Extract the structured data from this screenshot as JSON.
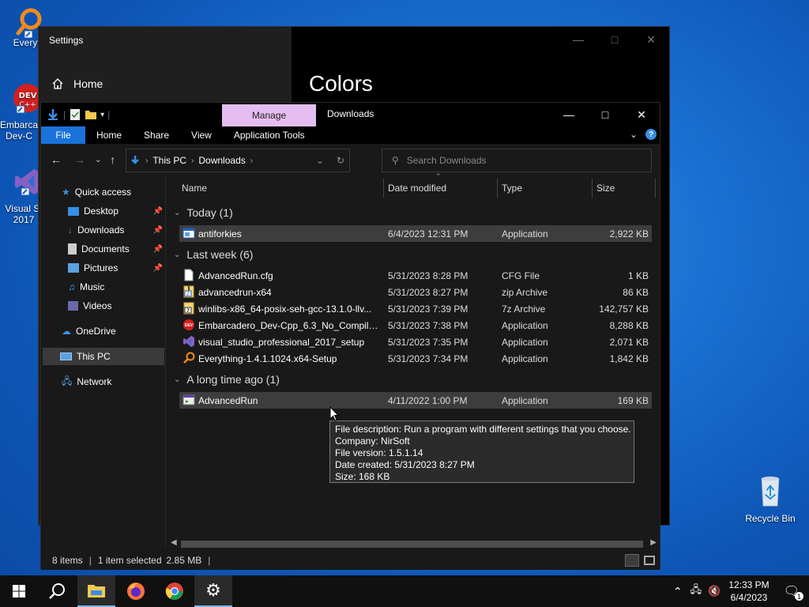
{
  "desktop": {
    "icons": [
      {
        "label": "Everyth",
        "icon": "everything-magnifier-icon"
      },
      {
        "label": "Embarca Dev-C",
        "icon": "devcpp-icon"
      },
      {
        "label": "Visual St 2017",
        "icon": "visual-studio-icon"
      },
      {
        "label": "Recycle Bin",
        "icon": "recycle-bin-icon"
      }
    ]
  },
  "settings": {
    "title": "Settings",
    "home_label": "Home",
    "page_title": "Colors"
  },
  "explorer": {
    "manage_label": "Manage",
    "title": "Downloads",
    "ribbon": {
      "file": "File",
      "home": "Home",
      "share": "Share",
      "view": "View",
      "app_tools": "Application Tools",
      "help": "?"
    },
    "address": {
      "crumb1": "This PC",
      "crumb2": "Downloads"
    },
    "search_placeholder": "Search Downloads",
    "nav": {
      "quick_access": "Quick access",
      "desktop": "Desktop",
      "downloads": "Downloads",
      "documents": "Documents",
      "pictures": "Pictures",
      "music": "Music",
      "videos": "Videos",
      "onedrive": "OneDrive",
      "thispc": "This PC",
      "network": "Network"
    },
    "columns": {
      "name": "Name",
      "date": "Date modified",
      "type": "Type",
      "size": "Size"
    },
    "groups": {
      "today": "Today (1)",
      "lastweek": "Last week (6)",
      "longago": "A long time ago (1)"
    },
    "files": [
      {
        "name": "antiforkies",
        "date": "6/4/2023 12:31 PM",
        "type": "Application",
        "size": "2,922 KB",
        "icon": "app-window-icon"
      },
      {
        "name": "AdvancedRun.cfg",
        "date": "5/31/2023 8:28 PM",
        "type": "CFG File",
        "size": "1 KB",
        "icon": "blank-file-icon"
      },
      {
        "name": "advancedrun-x64",
        "date": "5/31/2023 8:27 PM",
        "type": "zip Archive",
        "size": "86 KB",
        "icon": "zip-archive-icon"
      },
      {
        "name": "winlibs-x86_64-posix-seh-gcc-13.1.0-llv...",
        "date": "5/31/2023 7:39 PM",
        "type": "7z Archive",
        "size": "142,757 KB",
        "icon": "7z-archive-icon"
      },
      {
        "name": "Embarcadero_Dev-Cpp_6.3_No_Compiler...",
        "date": "5/31/2023 7:38 PM",
        "type": "Application",
        "size": "8,288 KB",
        "icon": "devcpp-icon"
      },
      {
        "name": "visual_studio_professional_2017_setup",
        "date": "5/31/2023 7:35 PM",
        "type": "Application",
        "size": "2,071 KB",
        "icon": "visual-studio-icon"
      },
      {
        "name": "Everything-1.4.1.1024.x64-Setup",
        "date": "5/31/2023 7:34 PM",
        "type": "Application",
        "size": "1,842 KB",
        "icon": "everything-magnifier-icon"
      },
      {
        "name": "AdvancedRun",
        "date": "4/11/2022 1:00 PM",
        "type": "Application",
        "size": "169 KB",
        "icon": "advancedrun-icon"
      }
    ],
    "status": {
      "items": "8 items",
      "selected": "1 item selected",
      "size": "2.85 MB"
    },
    "tooltip": {
      "line1": "File description: Run a program with different settings that you choose.",
      "line2": "Company: NirSoft",
      "line3": "File version: 1.5.1.14",
      "line4": "Date created: 5/31/2023 8:27 PM",
      "line5": "Size: 168 KB"
    }
  },
  "taskbar": {
    "time": "12:33 PM",
    "date": "6/4/2023",
    "notification_count": "1",
    "apps": [
      "start-icon",
      "search-icon",
      "file-explorer-icon",
      "firefox-icon",
      "chrome-icon",
      "settings-gear-icon"
    ]
  },
  "colors": {
    "accent": "#1a73d9",
    "manage_tab": "#e6bdf0",
    "selection": "#3d3d3d"
  }
}
